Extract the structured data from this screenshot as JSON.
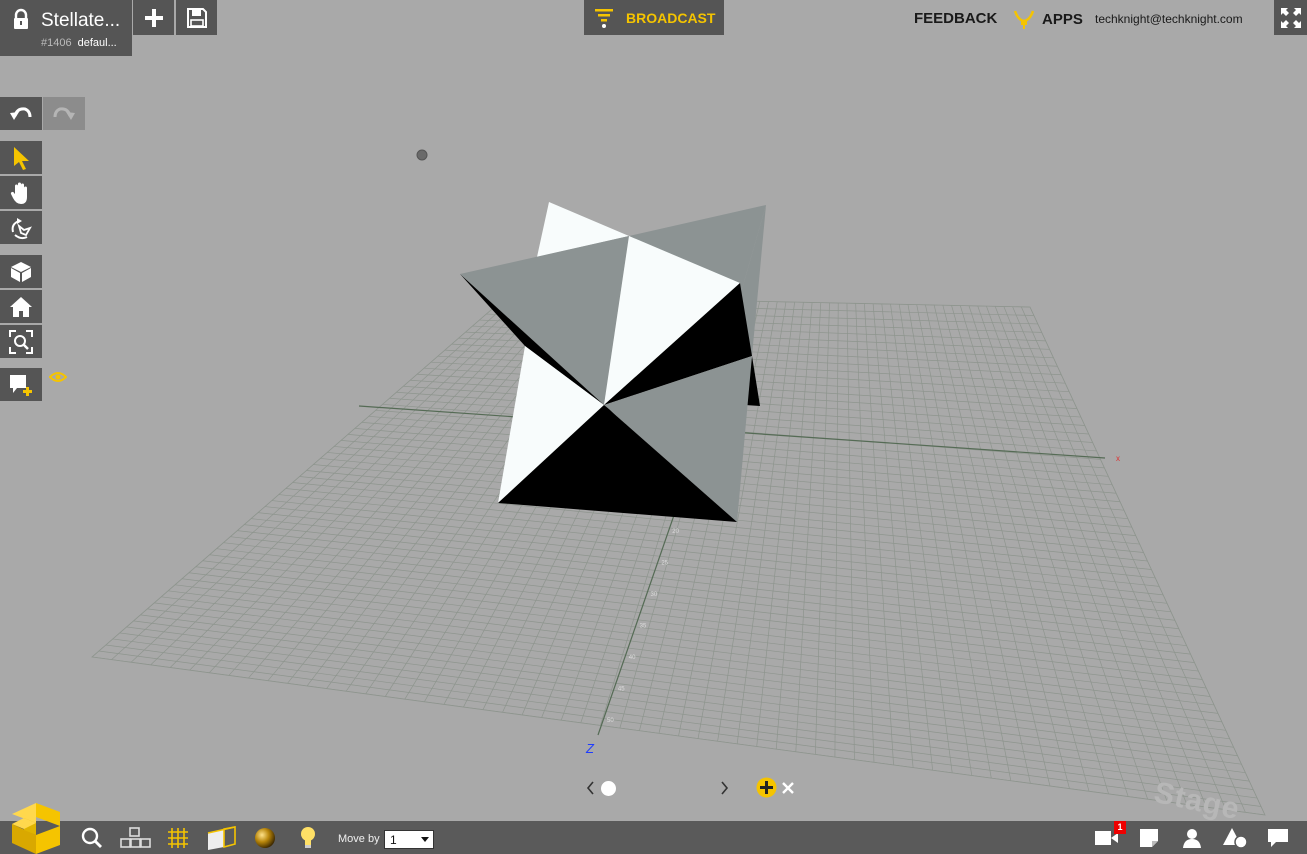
{
  "project": {
    "title": "Stellate...",
    "id": "#1406",
    "scene": "defaul..."
  },
  "header": {
    "broadcast_label": "BROADCAST",
    "feedback_label": "FEEDBACK",
    "apps_label": "APPS",
    "user_email": "techknight@techknight.com"
  },
  "viewport": {
    "x_axis_label": "x",
    "z_axis_label": "Z",
    "watermark": "Stage",
    "z_ticks": [
      "10",
      "15",
      "20",
      "25",
      "30",
      "35",
      "40",
      "45",
      "50"
    ]
  },
  "bottom_toolbar": {
    "move_by_label": "Move by",
    "move_by_value": "1",
    "notes_badge": "1"
  },
  "colors": {
    "accent": "#f5c400",
    "toolbar": "#555555",
    "background": "#a9a9a9"
  },
  "icons": {
    "left_toolbar": [
      "undo-icon",
      "redo-icon",
      "select-arrow-icon",
      "hand-pan-icon",
      "orbit-icon",
      "cube-view-icon",
      "home-icon",
      "zoom-fit-icon",
      "add-annotation-icon",
      "eye-icon"
    ],
    "bottom_left": [
      "logo-icon",
      "search-icon",
      "blocks-icon",
      "grid-icon",
      "material-icon",
      "sphere-icon",
      "light-bulb-icon"
    ],
    "bottom_right": [
      "scene-icon",
      "note-icon",
      "user-icon",
      "shapes-icon",
      "chat-icon"
    ]
  }
}
